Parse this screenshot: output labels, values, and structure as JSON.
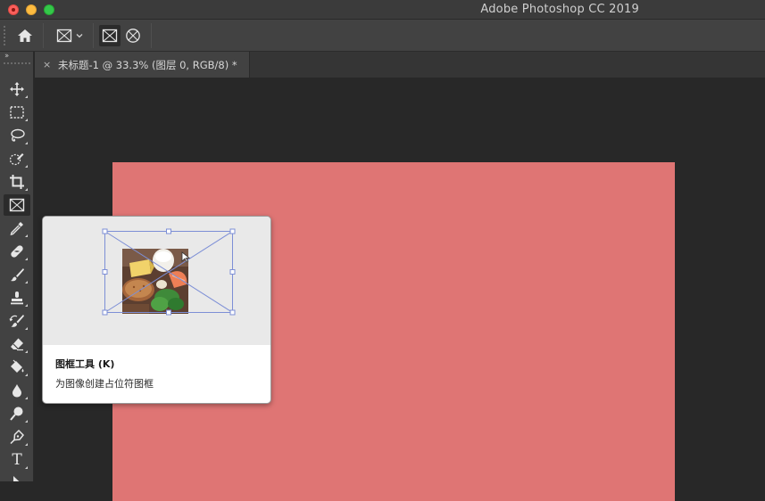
{
  "window": {
    "title": "Adobe Photoshop CC 2019"
  },
  "optionsbar": {
    "home_icon": "home-icon",
    "frame_preset_icon": "frame-rect-icon",
    "frame_rect_icon": "frame-rect-icon",
    "frame_ellipse_icon": "frame-ellipse-icon"
  },
  "document_tab": {
    "close_label": "×",
    "title": "未标题-1 @ 33.3% (图层 0, RGB/8) *"
  },
  "toolbar": {
    "collapse_label": "››",
    "tools": [
      {
        "name": "move-tool",
        "icon": "move-icon"
      },
      {
        "name": "rectangular-marquee-tool",
        "icon": "marquee-icon"
      },
      {
        "name": "lasso-tool",
        "icon": "lasso-icon"
      },
      {
        "name": "quick-selection-tool",
        "icon": "quick-select-icon"
      },
      {
        "name": "crop-tool",
        "icon": "crop-icon"
      },
      {
        "name": "frame-tool",
        "icon": "frame-icon",
        "active": true
      },
      {
        "name": "eyedropper-tool",
        "icon": "eyedropper-icon"
      },
      {
        "name": "healing-brush-tool",
        "icon": "bandage-icon"
      },
      {
        "name": "brush-tool",
        "icon": "brush-icon"
      },
      {
        "name": "clone-stamp-tool",
        "icon": "stamp-icon"
      },
      {
        "name": "history-brush-tool",
        "icon": "history-brush-icon"
      },
      {
        "name": "eraser-tool",
        "icon": "eraser-icon"
      },
      {
        "name": "paint-bucket-tool",
        "icon": "bucket-icon"
      },
      {
        "name": "blur-tool",
        "icon": "drop-icon"
      },
      {
        "name": "dodge-tool",
        "icon": "dodge-icon"
      },
      {
        "name": "pen-tool",
        "icon": "pen-icon"
      },
      {
        "name": "type-tool",
        "icon": "type-icon"
      },
      {
        "name": "path-selection-tool",
        "icon": "arrow-icon"
      }
    ],
    "type_tool_label": "T"
  },
  "canvas": {
    "fill_color": "#df7574"
  },
  "tooltip": {
    "title": "图框工具 (K)",
    "description": "为图像创建占位符图框"
  }
}
